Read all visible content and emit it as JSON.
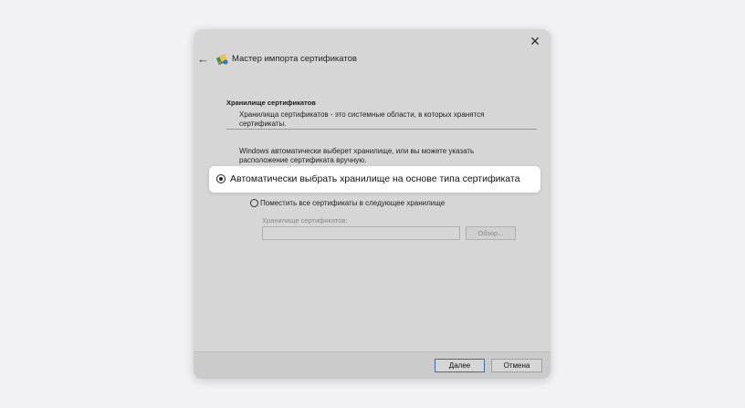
{
  "dialog": {
    "title": "Мастер импорта сертификатов",
    "close_symbol": "✕",
    "back_symbol": "←"
  },
  "section": {
    "title": "Хранилище сертификатов",
    "description": "Хранилища сертификатов - это системные области, в которых хранятся сертификаты."
  },
  "body_text": "Windows автоматически выберет хранилище, или вы можете указать расположение сертификата вручную.",
  "options": {
    "auto_label": "Автоматически выбрать хранилище на основе типа сертификата",
    "auto_selected": true,
    "manual_label": "Поместить все сертификаты в следующее хранилище",
    "manual_selected": false
  },
  "store": {
    "label": "Хранилище сертификатов:",
    "value": "",
    "browse_label": "Обзор..."
  },
  "footer": {
    "next_label": "Далее",
    "cancel_label": "Отмена"
  },
  "icons": {
    "close": "close-icon",
    "back": "arrow-left-icon",
    "wizard": "certificate-wizard-icon"
  },
  "colors": {
    "dialog_bg": "#d6d6d6",
    "highlight_bg": "#ffffff",
    "default_button_border": "#3a6ea5"
  }
}
